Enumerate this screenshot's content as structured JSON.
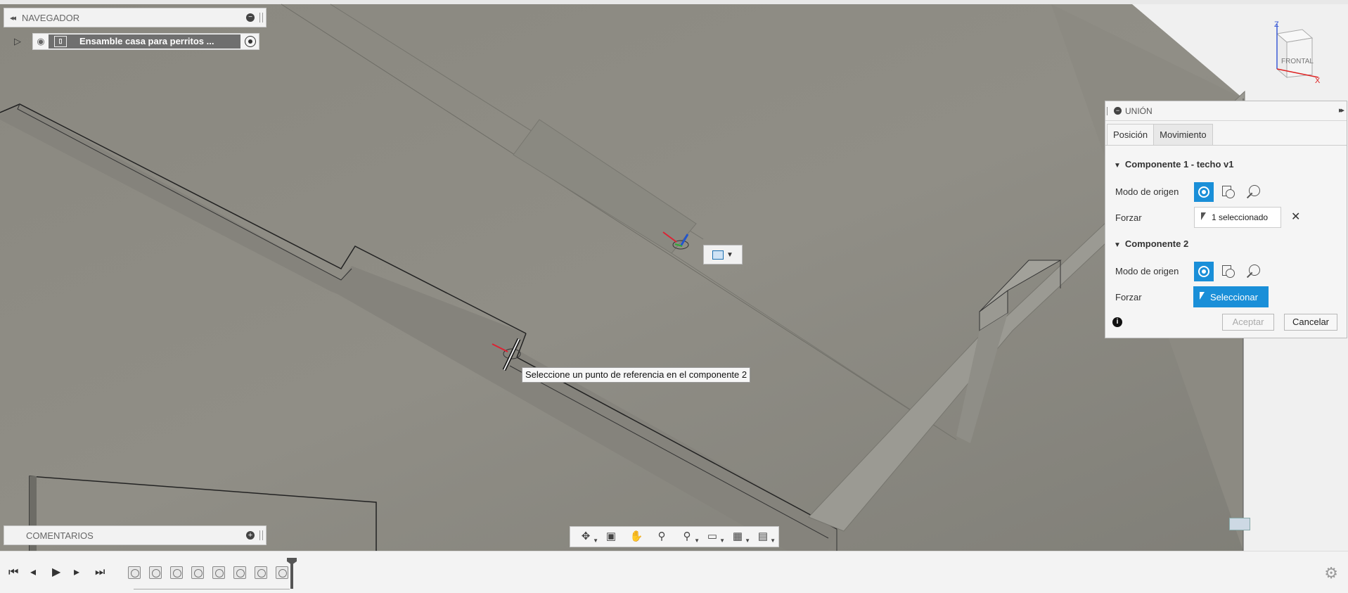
{
  "navigator": {
    "title": "NAVEGADOR",
    "root_item": "Ensamble casa para perritos ..."
  },
  "comments": {
    "title": "COMENTARIOS"
  },
  "viewcube": {
    "face_label": "FRONTAL",
    "axis_z": "Z",
    "axis_x": "X"
  },
  "tooltip": {
    "text": "Seleccione un punto de referencia en el componente 2"
  },
  "union_dialog": {
    "title": "UNIÓN",
    "tabs": [
      "Posición",
      "Movimiento"
    ],
    "component1": {
      "header": "Componente 1 - techo v1",
      "origin_mode_label": "Modo de origen",
      "snap_label": "Forzar",
      "snap_value": "1 seleccionado"
    },
    "component2": {
      "header": "Componente 2",
      "origin_mode_label": "Modo de origen",
      "snap_label": "Forzar",
      "snap_value": "Seleccionar"
    },
    "ok_label": "Aceptar",
    "cancel_label": "Cancelar"
  },
  "colors": {
    "accent": "#1a8fd8",
    "canvas": "#8e8c84",
    "panel": "#f5f5f5"
  },
  "icons": {
    "bottom_toolbar": [
      "orbit-icon",
      "look-at-icon",
      "pan-icon",
      "zoom-icon",
      "fit-icon",
      "display-settings-icon",
      "grid-icon",
      "viewports-icon"
    ],
    "timeline": [
      "go-to-start-icon",
      "step-back-icon",
      "play-icon",
      "step-forward-icon",
      "go-to-end-icon"
    ]
  }
}
